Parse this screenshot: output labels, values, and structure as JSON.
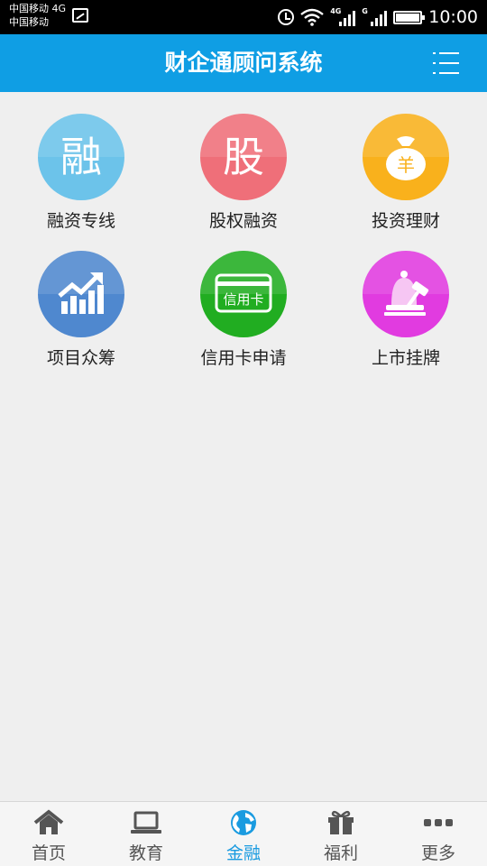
{
  "status_bar": {
    "carrier_1": "中国移动 4G",
    "carrier_2": "中国移动",
    "signal_1_tag": "4G",
    "signal_2_tag": "G",
    "time": "10:00"
  },
  "app_bar": {
    "title": "财企通顾问系统",
    "menu_icon": "list-menu-icon"
  },
  "services": [
    {
      "label": "融资专线",
      "glyph": "融",
      "icon": "financing-icon",
      "color": "#6cc3ea"
    },
    {
      "label": "股权融资",
      "glyph": "股",
      "icon": "equity-icon",
      "color": "#ef6f79"
    },
    {
      "label": "投资理财",
      "glyph": "",
      "icon": "money-bag-icon",
      "color": "#f9b11c"
    },
    {
      "label": "项目众筹",
      "glyph": "",
      "icon": "growth-chart-icon",
      "color": "#4f88cf"
    },
    {
      "label": "信用卡申请",
      "glyph": "",
      "icon": "credit-card-icon",
      "color": "#21ad21"
    },
    {
      "label": "上市挂牌",
      "glyph": "",
      "icon": "auction-bell-icon",
      "color": "#e13be0"
    }
  ],
  "money_bag_symbol": "羊",
  "credit_card_text": "信用卡",
  "bottom_nav": [
    {
      "label": "首页",
      "icon": "home-icon",
      "active": false
    },
    {
      "label": "教育",
      "icon": "laptop-icon",
      "active": false
    },
    {
      "label": "金融",
      "icon": "globe-icon",
      "active": true
    },
    {
      "label": "福利",
      "icon": "gift-icon",
      "active": false
    },
    {
      "label": "更多",
      "icon": "more-dots-icon",
      "active": false
    }
  ],
  "colors": {
    "app_bar": "#0f9ee4",
    "background": "#efefef",
    "active_tab": "#1a9be0"
  }
}
